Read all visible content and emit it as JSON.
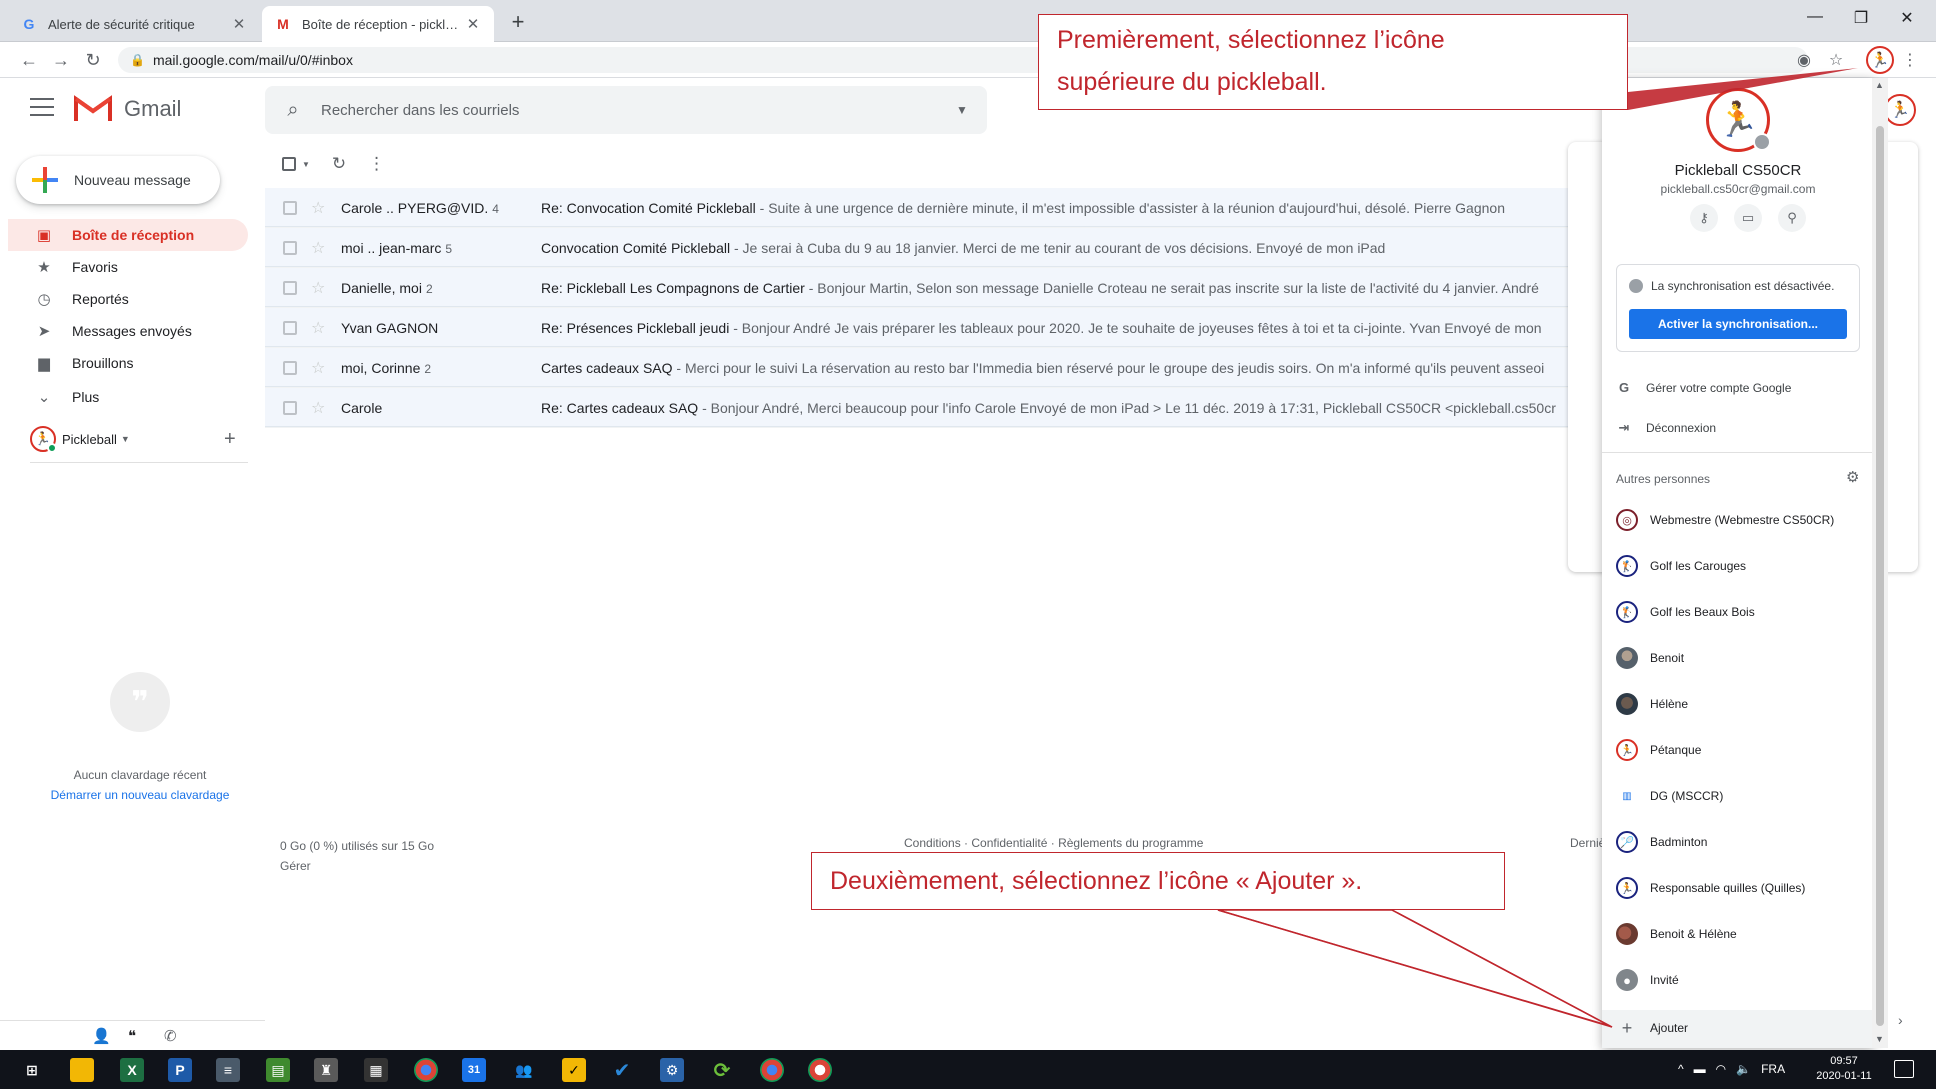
{
  "browser": {
    "tabs": [
      {
        "title": "Alerte de sécurité critique",
        "icon": "google-g-icon"
      },
      {
        "title": "Boîte de réception - pickleball.cs",
        "icon": "gmail-m-icon"
      }
    ],
    "url": "mail.google.com/mail/u/0/#inbox"
  },
  "gmail": {
    "logo_text": "Gmail",
    "search_placeholder": "Rechercher dans les courriels",
    "compose_label": "Nouveau message",
    "nav": [
      {
        "label": "Boîte de réception",
        "icon": "inbox-icon",
        "active": true
      },
      {
        "label": "Favoris",
        "icon": "star-icon"
      },
      {
        "label": "Reportés",
        "icon": "clock-icon"
      },
      {
        "label": "Messages envoyés",
        "icon": "send-icon"
      },
      {
        "label": "Brouillons",
        "icon": "draft-icon"
      },
      {
        "label": "Plus",
        "icon": "chevron-down-icon"
      }
    ],
    "hangouts_user": "Pickleball",
    "chat_empty": "Aucun clavardage récent",
    "chat_start": "Démarrer un nouveau clavardage",
    "emails": [
      {
        "from": "Carole .. PYERG@VID.",
        "count": "4",
        "subject": "Re: Convocation Comité Pickleball",
        "snippet": " - Suite à une urgence de dernière minute, il m'est impossible d'assister à la réunion d'aujourd'hui, désolé. Pierre Gagnon"
      },
      {
        "from": "moi .. jean-marc",
        "count": "5",
        "subject": "Convocation Comité Pickleball",
        "snippet": " - Je serai à Cuba du 9 au 18 janvier. Merci de me tenir au courant de vos décisions. Envoyé de mon iPad"
      },
      {
        "from": "Danielle, moi",
        "count": "2",
        "subject": "Re: Pickleball Les Compagnons de Cartier",
        "snippet": " - Bonjour Martin, Selon son message Danielle Croteau ne serait pas inscrite sur la liste de l'activité du 4 janvier. André"
      },
      {
        "from": "Yvan GAGNON",
        "count": "",
        "subject": "Re: Présences Pickleball jeudi",
        "snippet": " - Bonjour André Je vais préparer les tableaux pour 2020. Je te souhaite de joyeuses fêtes à toi et ta ci-jointe. Yvan Envoyé de mon"
      },
      {
        "from": "moi, Corinne",
        "count": "2",
        "subject": "Cartes cadeaux SAQ",
        "snippet": " - Merci pour le suivi La réservation au resto bar l'Immedia bien réservé pour le groupe des jeudis soirs. On m'a informé qu'ils peuvent asseoi"
      },
      {
        "from": "Carole",
        "count": "",
        "subject": "Re: Cartes cadeaux SAQ",
        "snippet": " - Bonjour André, Merci beaucoup pour l'info Carole Envoyé de mon iPad > Le 11 déc. 2019 à 17:31, Pickleball CS50CR <pickleball.cs50cr"
      }
    ],
    "storage": "0 Go (0 %) utilisés sur 15 Go",
    "manage": "Gérer",
    "terms": "Conditions · Confidentialité · Règlements du programme",
    "last_activity": "Derniè"
  },
  "profile": {
    "name": "Pickleball CS50CR",
    "email": "pickleball.cs50cr@gmail.com",
    "sync_status": "La synchronisation est désactivée.",
    "sync_button": "Activer la synchronisation...",
    "manage_account": "Gérer votre compte Google",
    "logout": "Déconnexion",
    "others_label": "Autres personnes",
    "people": [
      {
        "name": "Webmestre (Webmestre CS50CR)",
        "avatar": "swirl"
      },
      {
        "name": "Golf les Carouges",
        "avatar": "navy"
      },
      {
        "name": "Golf les Beaux Bois",
        "avatar": "navy"
      },
      {
        "name": "Benoit",
        "avatar": "photo1"
      },
      {
        "name": "Hélène",
        "avatar": "photo2"
      },
      {
        "name": "Pétanque",
        "avatar": "red"
      },
      {
        "name": "DG (MSCCR)",
        "avatar": "plain"
      },
      {
        "name": "Badminton",
        "avatar": "navy"
      },
      {
        "name": "Responsable quilles (Quilles)",
        "avatar": "navy"
      },
      {
        "name": "Benoit & Hélène",
        "avatar": "photo3"
      },
      {
        "name": "Invité",
        "avatar": "grey"
      }
    ],
    "add_label": "Ajouter"
  },
  "annotations": {
    "step1_line1": "Premièrement, sélectionnez l’icône",
    "step1_line2": "supérieure du pickleball.",
    "step2": "Deuxièmement, sélectionnez l’icône  « Ajouter »."
  },
  "taskbar": {
    "lang": "FRA",
    "time": "09:57",
    "date": "2020-01-11"
  },
  "colors": {
    "accent_red": "#d93025",
    "annotation_red": "#c0262d",
    "blue": "#1a73e8"
  }
}
